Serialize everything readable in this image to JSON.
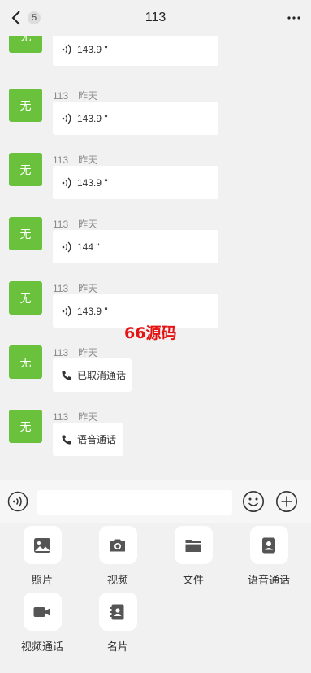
{
  "header": {
    "title": "113",
    "unread_count": "5"
  },
  "messages": [
    {
      "avatar": "无",
      "sender": "",
      "time": "",
      "type": "voice",
      "text": "143.9 \""
    },
    {
      "avatar": "无",
      "sender": "113",
      "time": "昨天",
      "type": "voice",
      "text": "143.9 \""
    },
    {
      "avatar": "无",
      "sender": "113",
      "time": "昨天",
      "type": "voice",
      "text": "143.9 \""
    },
    {
      "avatar": "无",
      "sender": "113",
      "time": "昨天",
      "type": "voice",
      "text": "144 \""
    },
    {
      "avatar": "无",
      "sender": "113",
      "time": "昨天",
      "type": "voice",
      "text": "143.9 \""
    },
    {
      "avatar": "无",
      "sender": "113",
      "time": "昨天",
      "type": "call",
      "text": "已取消通话"
    },
    {
      "avatar": "无",
      "sender": "113",
      "time": "昨天",
      "type": "call",
      "text": "语音通话"
    }
  ],
  "watermark": "66源码",
  "input": {
    "value": "",
    "placeholder": ""
  },
  "panel": {
    "tools": [
      {
        "label": "照片",
        "icon": "image-icon"
      },
      {
        "label": "视频",
        "icon": "camera-icon"
      },
      {
        "label": "文件",
        "icon": "folder-icon"
      },
      {
        "label": "语音通话",
        "icon": "contact-phone-icon"
      },
      {
        "label": "视频通话",
        "icon": "video-camera-icon"
      },
      {
        "label": "名片",
        "icon": "business-card-icon"
      }
    ]
  },
  "colors": {
    "avatar_bg": "#6ac23c",
    "watermark": "#e31313",
    "background": "#f1f1f1"
  }
}
